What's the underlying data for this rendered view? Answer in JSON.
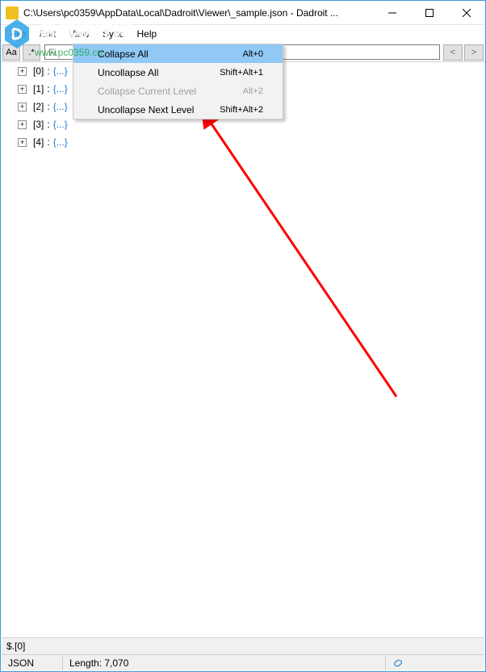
{
  "window": {
    "title": "C:\\Users\\pc0359\\AppData\\Local\\Dadroit\\Viewer\\_sample.json - Dadroit ..."
  },
  "menubar": {
    "items": [
      "File",
      "Edit",
      "View",
      "Sync",
      "Help"
    ]
  },
  "toolbar": {
    "aa": "Aa",
    "star": ".*",
    "search_placeholder": "Fi",
    "prev": "<",
    "next": ">"
  },
  "tree": {
    "rows": [
      {
        "key": "[0]",
        "val": "{...}"
      },
      {
        "key": "[1]",
        "val": "{...}"
      },
      {
        "key": "[2]",
        "val": "{...}"
      },
      {
        "key": "[3]",
        "val": "{...}"
      },
      {
        "key": "[4]",
        "val": "{...}"
      }
    ]
  },
  "context_menu": {
    "items": [
      {
        "label": "Collapse All",
        "shortcut": "Alt+0",
        "highlighted": true,
        "enabled": true
      },
      {
        "label": "Uncollapse All",
        "shortcut": "Shift+Alt+1",
        "highlighted": false,
        "enabled": true
      },
      {
        "label": "Collapse Current Level",
        "shortcut": "Alt+2",
        "highlighted": false,
        "enabled": false
      },
      {
        "label": "Uncollapse Next Level",
        "shortcut": "Shift+Alt+2",
        "highlighted": false,
        "enabled": true
      }
    ]
  },
  "status": {
    "path": "$.[0]",
    "type": "JSON",
    "length": "Length: 7,070"
  },
  "watermark": {
    "main": "测试软件网",
    "sub": "www.pc0359.cn"
  }
}
